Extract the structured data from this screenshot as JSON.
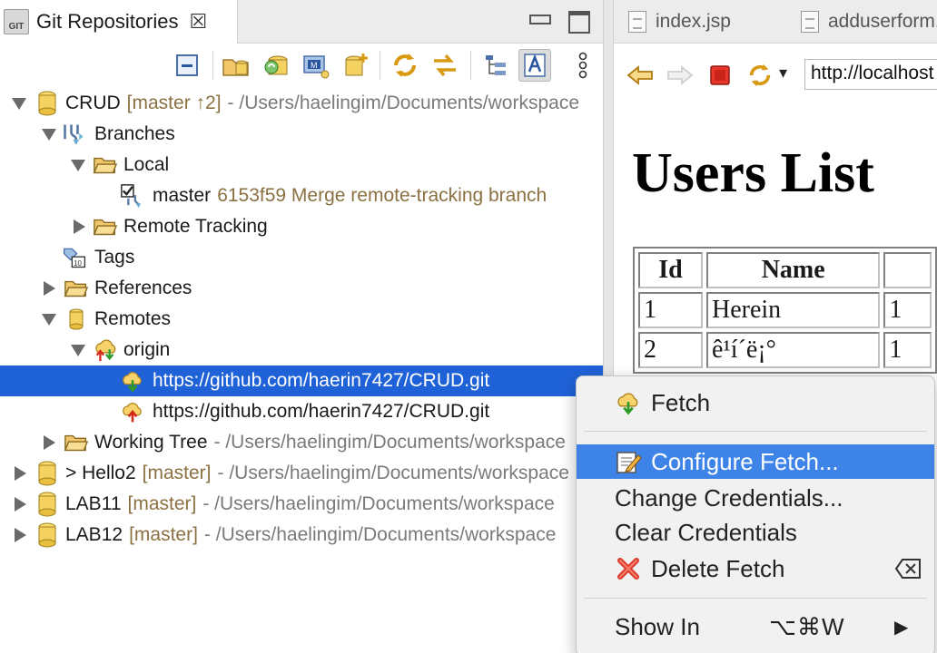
{
  "left_view": {
    "tab_title": "Git Repositories",
    "tab_icon_text": "GIT",
    "close_glyph": "☒"
  },
  "tree": [
    {
      "label": "CRUD",
      "branch": "[master ↑2]",
      "path": "- /Users/haelingim/Documents/workspace",
      "icon": "repository-icon",
      "expanded": true
    },
    {
      "label": "Branches",
      "icon": "branches-icon",
      "expanded": true
    },
    {
      "label": "Local",
      "icon": "folder-open-icon",
      "expanded": true
    },
    {
      "label": "master",
      "branch": "6153f59 Merge remote-tracking branch",
      "icon": "checked-out-branch-icon"
    },
    {
      "label": "Remote Tracking",
      "icon": "folder-open-icon",
      "expanded": false
    },
    {
      "label": "Tags",
      "icon": "tags-icon"
    },
    {
      "label": "References",
      "icon": "folder-open-icon",
      "expanded": false
    },
    {
      "label": "Remotes",
      "icon": "repository-icon",
      "expanded": true
    },
    {
      "label": "origin",
      "icon": "remote-icon",
      "expanded": true
    },
    {
      "label": "https://github.com/haerin7427/CRUD.git",
      "icon": "fetch-icon",
      "selected": true
    },
    {
      "label": "https://github.com/haerin7427/CRUD.git",
      "icon": "push-icon"
    },
    {
      "label": "Working Tree",
      "path": "- /Users/haelingim/Documents/workspace",
      "icon": "folder-open-icon",
      "expanded": false
    },
    {
      "label": "> Hello2",
      "branch": "[master]",
      "path": "- /Users/haelingim/Documents/workspace",
      "icon": "repository-icon",
      "expanded": false
    },
    {
      "label": "LAB11",
      "branch": "[master]",
      "path": "- /Users/haelingim/Documents/workspace",
      "icon": "repository-icon",
      "expanded": false
    },
    {
      "label": "LAB12",
      "branch": "[master]",
      "path": "- /Users/haelingim/Documents/workspace",
      "icon": "repository-icon",
      "expanded": false
    }
  ],
  "editor": {
    "tabs": [
      "index.jsp",
      "adduserform.jsp"
    ],
    "url": "http://localhost",
    "dropdown_glyph": "▾",
    "heading": "Users List",
    "table": {
      "headers": [
        "Id",
        "Name",
        ""
      ],
      "rows": [
        [
          "1",
          "Herein",
          "1"
        ],
        [
          "2",
          "ê¹í´ë¡°",
          "1"
        ]
      ]
    }
  },
  "context_menu": {
    "fetch": "Fetch",
    "configure_fetch": "Configure Fetch...",
    "change_credentials": "Change Credentials...",
    "clear_credentials": "Clear Credentials",
    "delete_fetch": "Delete Fetch",
    "show_in": "Show In",
    "show_in_shortcut": "⌥⌘W",
    "submenu_glyph": "▶"
  },
  "colors": {
    "selection": "#1f62d8",
    "menu_highlight": "#3d83e8",
    "branch_text": "#8b7142",
    "path_text": "#7a7a7a"
  }
}
